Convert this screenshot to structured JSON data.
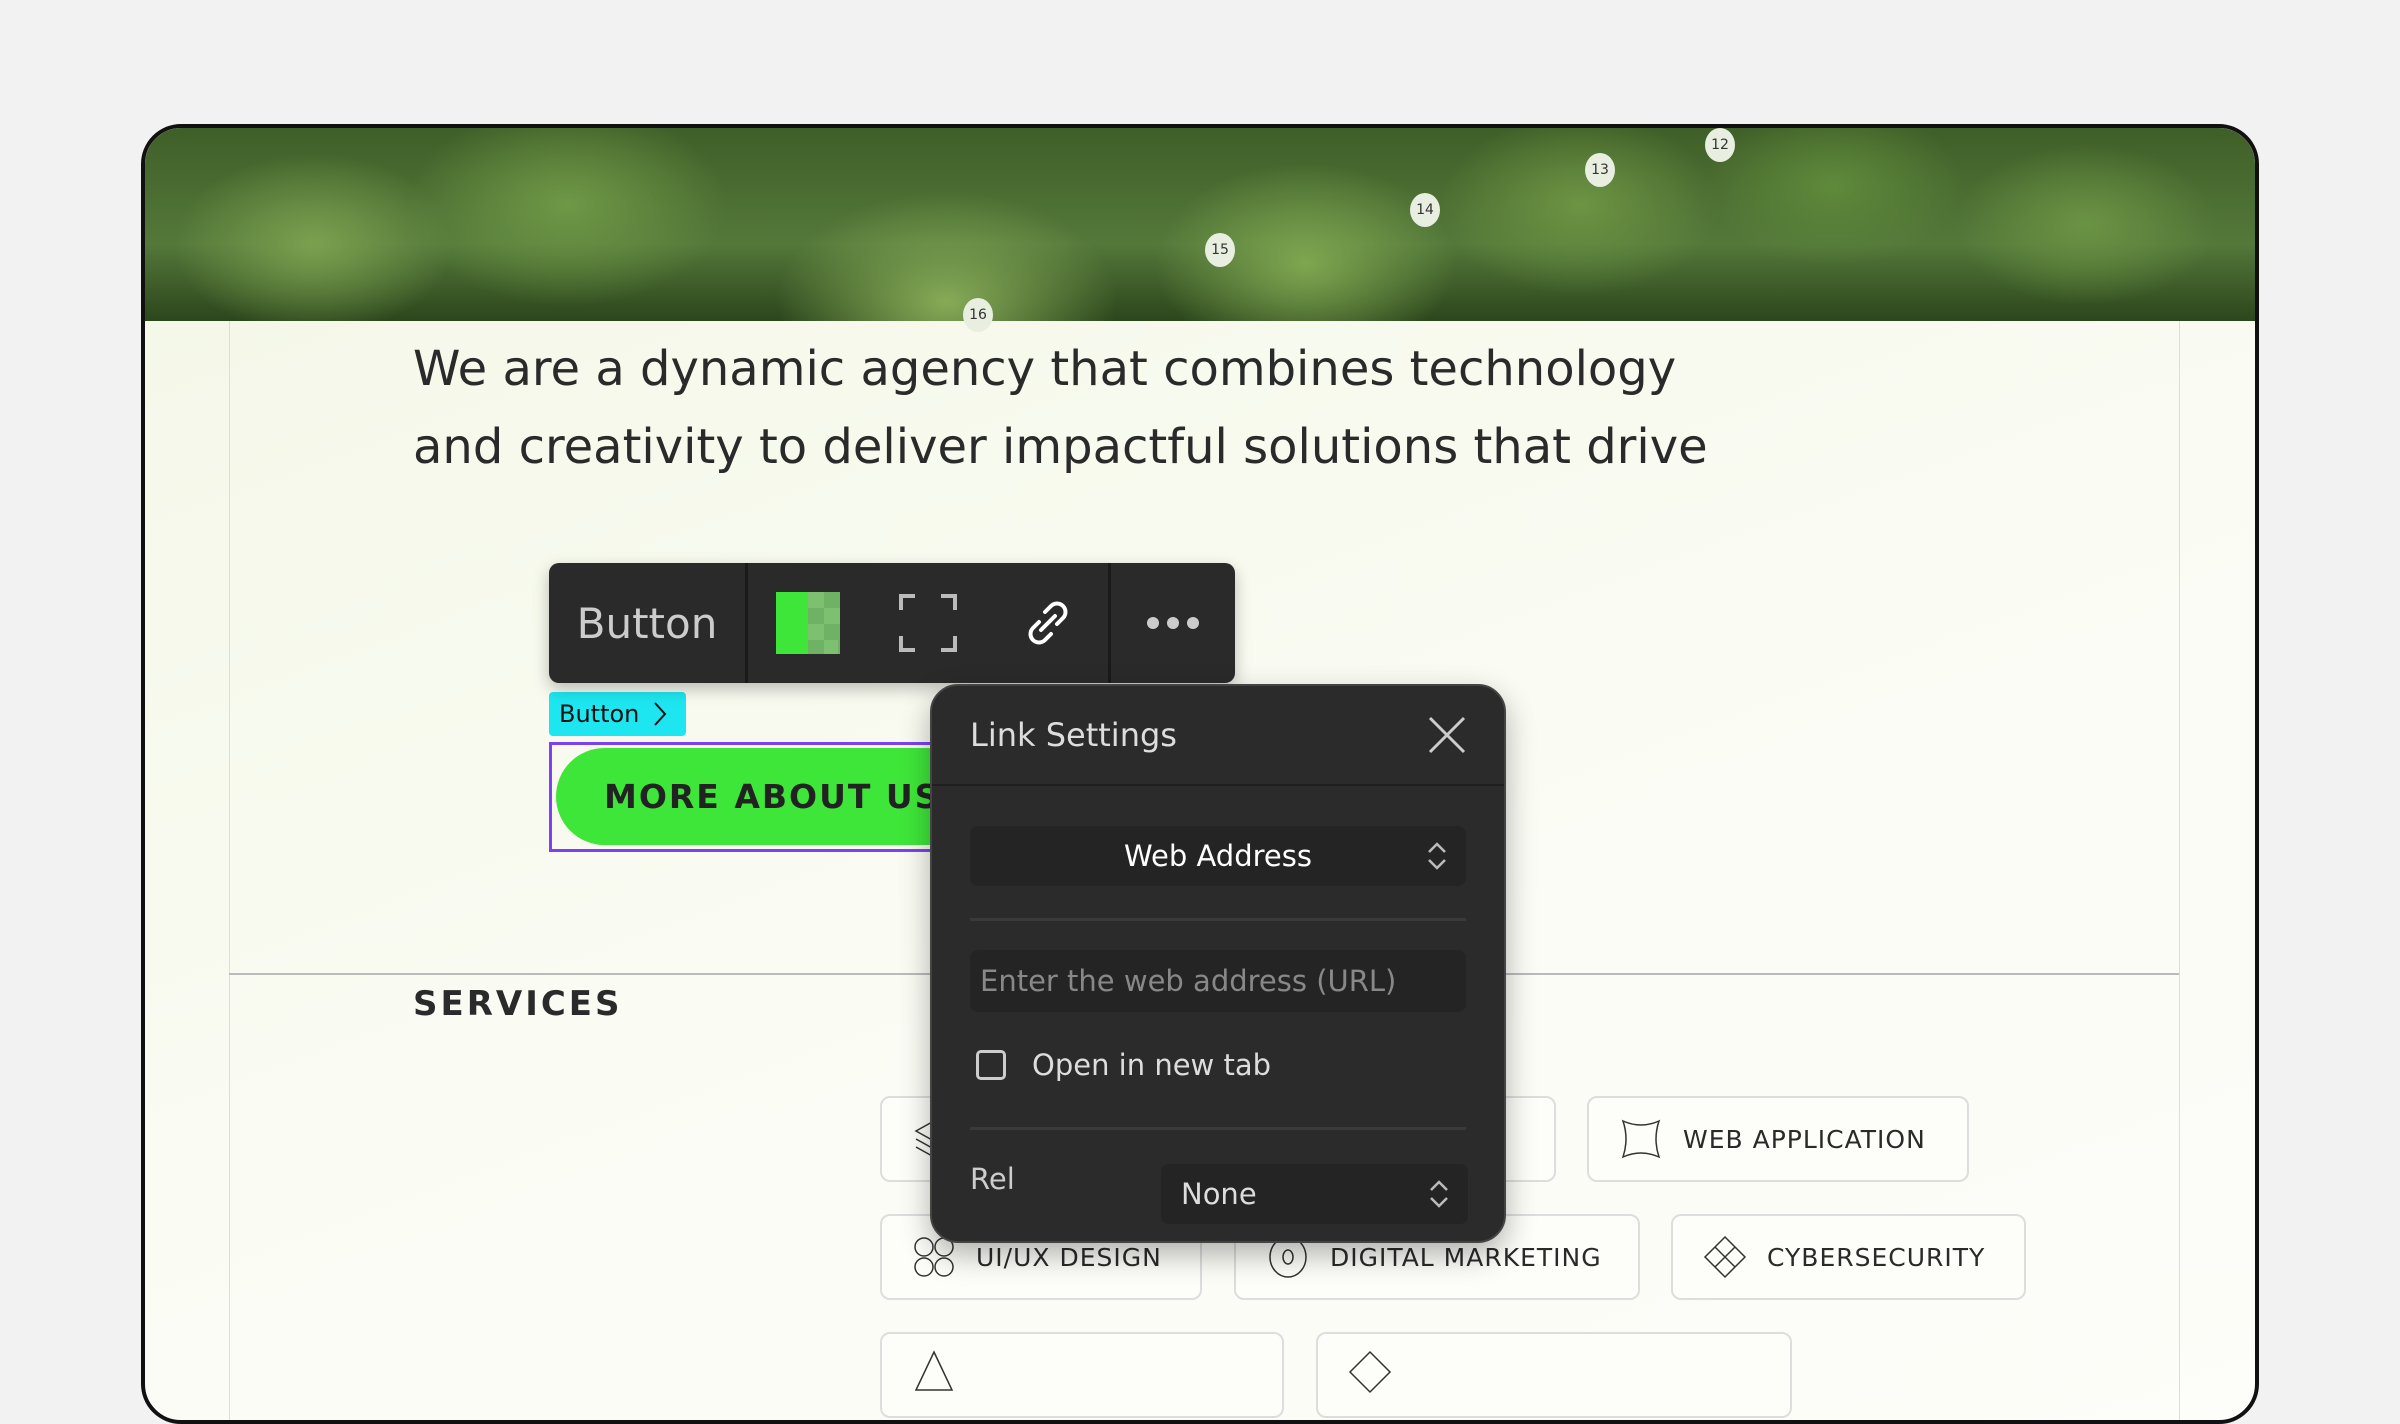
{
  "hero": {
    "seat_numbers": [
      "16",
      "15",
      "14",
      "13",
      "12"
    ]
  },
  "main": {
    "paragraph_lines": [
      "We are a dynamic agency that combines technology",
      "and creativity to deliver impactful solutions that drive"
    ],
    "cta_label": "MORE ABOUT US",
    "services_heading": "SERVICES",
    "services": [
      {
        "label": "",
        "icon": "layers-icon"
      },
      {
        "label": "WEB APPLICATION",
        "icon": "frame-icon"
      },
      {
        "label": "UI/UX DESIGN",
        "icon": "circles-icon"
      },
      {
        "label": "DIGITAL MARKETING",
        "icon": "target-icon"
      },
      {
        "label": "CYBERSECURITY",
        "icon": "diamond-grid-icon"
      },
      {
        "label": "",
        "icon": "triangle-icon"
      },
      {
        "label": "",
        "icon": "diamond-icon"
      }
    ]
  },
  "toolbar": {
    "element_label": "Button",
    "icons": [
      "color-swatch-icon",
      "resize-icon",
      "link-icon",
      "more-icon"
    ]
  },
  "breadcrumb": {
    "label": "Button"
  },
  "link_settings": {
    "title": "Link Settings",
    "type_select": "Web Address",
    "url_placeholder": "Enter the web address (URL)",
    "url_value": "",
    "open_new_tab_label": "Open in new tab",
    "open_new_tab_checked": false,
    "rel_label": "Rel",
    "rel_value": "None"
  },
  "colors": {
    "accent_green": "#3fe63a",
    "selection_purple": "#7b42f5",
    "breadcrumb_cyan": "#1ee6f0",
    "panel_bg": "#2b2b2b"
  }
}
